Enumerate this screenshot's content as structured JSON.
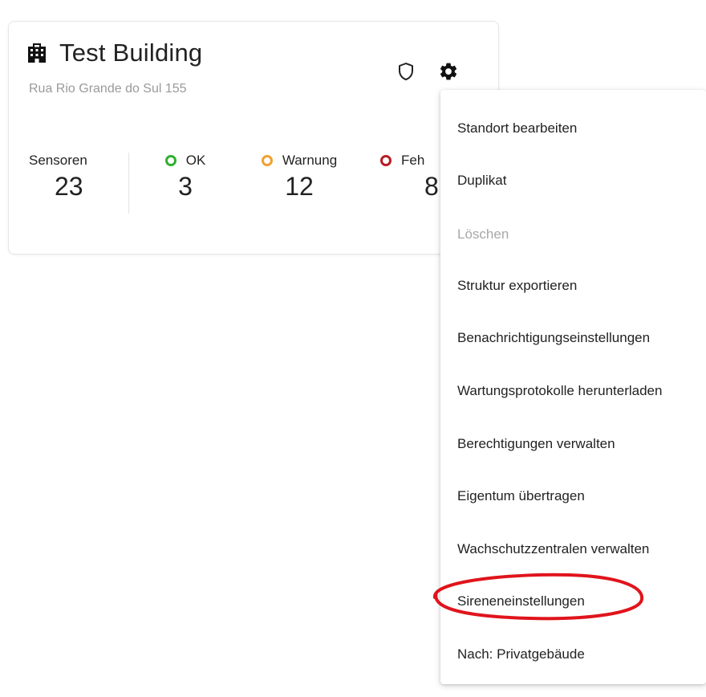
{
  "card": {
    "title": "Test Building",
    "address": "Rua Rio Grande do Sul 155",
    "stats": {
      "sensors": {
        "label": "Sensoren",
        "value": "23"
      },
      "ok": {
        "label": "OK",
        "value": "3",
        "color": "#2fb02f"
      },
      "warning": {
        "label": "Warnung",
        "value": "12",
        "color": "#f0a030"
      },
      "error": {
        "label": "Feh",
        "value": "8",
        "color": "#b81c24"
      }
    }
  },
  "icons": {
    "building": "building-icon",
    "shield": "shield-icon",
    "gear": "gear-icon"
  },
  "menu": {
    "items": [
      {
        "label": "Standort bearbeiten",
        "disabled": false
      },
      {
        "label": "Duplikat",
        "disabled": false
      },
      {
        "label": "Löschen",
        "disabled": true
      },
      {
        "label": "Struktur exportieren",
        "disabled": false
      },
      {
        "label": "Benachrichtigungseinstellungen",
        "disabled": false
      },
      {
        "label": "Wartungsprotokolle herunterladen",
        "disabled": false
      },
      {
        "label": "Berechtigungen verwalten",
        "disabled": false
      },
      {
        "label": "Eigentum übertragen",
        "disabled": false
      },
      {
        "label": "Wachschutzzentralen verwalten",
        "disabled": false
      },
      {
        "label": "Sireneneinstellungen",
        "disabled": false
      },
      {
        "label": "Nach: Privatgebäude",
        "disabled": false
      }
    ]
  },
  "annotation": {
    "highlight_color": "#e0141c",
    "highlighted_item": "Sireneneinstellungen"
  }
}
